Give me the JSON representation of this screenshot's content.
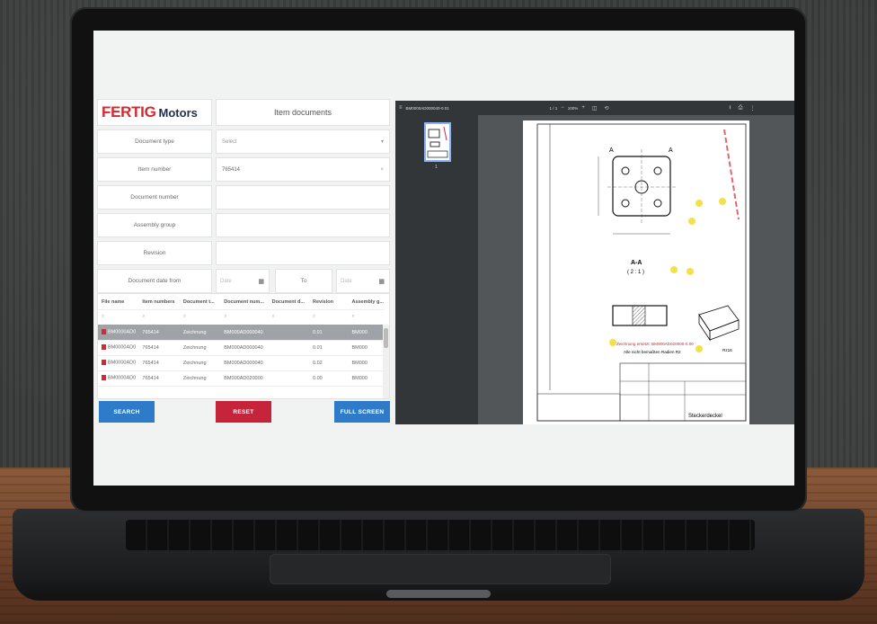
{
  "app": {
    "logo_primary": "FERTIG",
    "logo_secondary": "Motors",
    "panel_title": "Item documents"
  },
  "form": {
    "document_type_label": "Document type",
    "document_type_value": "Select",
    "item_number_label": "Item number",
    "item_number_value": "765414",
    "document_number_label": "Document number",
    "assembly_group_label": "Assembly group",
    "revision_label": "Revision",
    "date_from_label": "Document date from",
    "date_placeholder": "Date",
    "to_label": "To"
  },
  "grid": {
    "columns": [
      "File name",
      "Item numbers",
      "Document t...",
      "Document num...",
      "Document d...",
      "Revision",
      "Assembly g..."
    ],
    "rows": [
      [
        "BM0000AD0",
        "765414",
        "Zeichnung",
        "BM000AD000040",
        "",
        "0.01",
        "BM000"
      ],
      [
        "BM0000AD0",
        "765414",
        "Zeichnung",
        "BM000AD000040",
        "",
        "0.01",
        "BM000"
      ],
      [
        "BM0000AD0",
        "765414",
        "Zeichnung",
        "BM000AD000040",
        "",
        "0.02",
        "BM000"
      ],
      [
        "BM0000AD0",
        "765414",
        "Zeichnung",
        "BM000AD020000",
        "",
        "0.00",
        "BM000"
      ]
    ]
  },
  "buttons": {
    "search": "SEARCH",
    "reset": "RESET",
    "full_screen": "FULL SCREEN"
  },
  "viewer": {
    "file_title": "BM0000AD000040-0.01",
    "page_indicator": "1 / 1",
    "zoom": "100%",
    "thumb_page": "1",
    "drawing": {
      "section_label": "A-A",
      "scale": "( 2 : 1 )",
      "replaced_note": "Zeichnung ersetzt: BM000AD020000-0.00",
      "edge_note": "Alle nicht bemaßten Radien R2",
      "title_block_name": "Steckerdeckel",
      "roughness": "Rz16"
    }
  }
}
